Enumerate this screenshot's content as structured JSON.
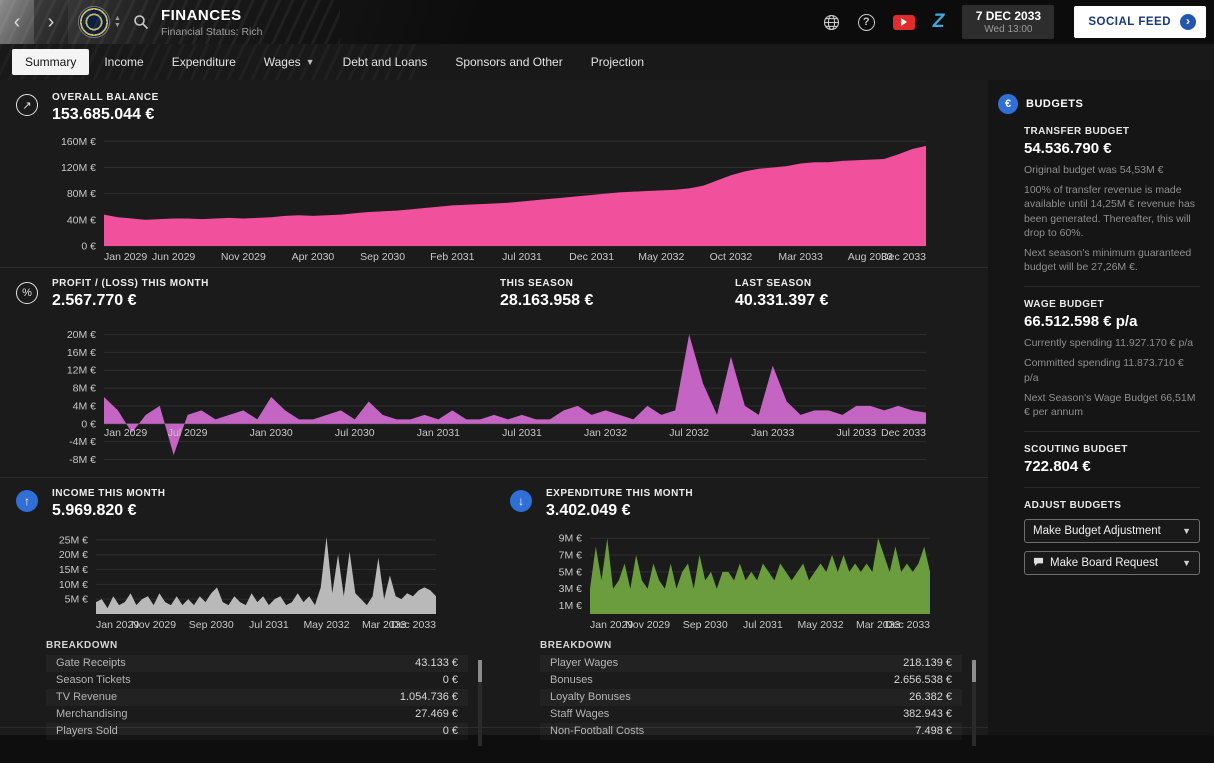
{
  "header": {
    "title": "FINANCES",
    "subtitle": "Financial Status: Rich",
    "date": "7 DEC 2033",
    "date_sub": "Wed 13:00",
    "social_feed_label": "SOCIAL FEED"
  },
  "tabs": [
    {
      "label": "Summary",
      "active": true
    },
    {
      "label": "Income"
    },
    {
      "label": "Expenditure"
    },
    {
      "label": "Wages",
      "dropdown": true
    },
    {
      "label": "Debt and Loans"
    },
    {
      "label": "Sponsors and Other"
    },
    {
      "label": "Projection"
    }
  ],
  "balance_panel": {
    "label": "OVERALL BALANCE",
    "value": "153.685.044 €"
  },
  "profit_panel": {
    "label": "PROFIT / (LOSS) THIS MONTH",
    "value": "2.567.770 €",
    "this_season_label": "THIS SEASON",
    "this_season_value": "28.163.958 €",
    "last_season_label": "LAST SEASON",
    "last_season_value": "40.331.397 €"
  },
  "income_panel": {
    "label": "INCOME THIS MONTH",
    "value": "5.969.820 €",
    "breakdown_label": "BREAKDOWN",
    "rows": [
      {
        "name": "Gate Receipts",
        "value": "43.133 €"
      },
      {
        "name": "Season Tickets",
        "value": "0 €"
      },
      {
        "name": "TV Revenue",
        "value": "1.054.736 €"
      },
      {
        "name": "Merchandising",
        "value": "27.469 €"
      },
      {
        "name": "Players Sold",
        "value": "0 €"
      }
    ]
  },
  "expenditure_panel": {
    "label": "EXPENDITURE THIS MONTH",
    "value": "3.402.049 €",
    "breakdown_label": "BREAKDOWN",
    "rows": [
      {
        "name": "Player Wages",
        "value": "218.139 €"
      },
      {
        "name": "Bonuses",
        "value": "2.656.538 €"
      },
      {
        "name": "Loyalty Bonuses",
        "value": "26.382 €"
      },
      {
        "name": "Staff Wages",
        "value": "382.943 €"
      },
      {
        "name": "Non-Football Costs",
        "value": "7.498 €"
      }
    ]
  },
  "sidebar": {
    "title": "BUDGETS",
    "transfer_label": "TRANSFER BUDGET",
    "transfer_value": "54.536.790 €",
    "transfer_note1": "Original budget was 54,53M €",
    "transfer_note2": "100% of transfer revenue is made available until 14,25M € revenue has been generated. Thereafter, this will drop to 60%.",
    "transfer_note3": "Next season's minimum guaranteed budget will be 27,26M €.",
    "wage_label": "WAGE BUDGET",
    "wage_value": "66.512.598 € p/a",
    "wage_note1": "Currently spending 11.927.170 € p/a",
    "wage_note2": "Committed spending 11.873.710 € p/a",
    "wage_note3": "Next Season's Wage Budget 66,51M € per annum",
    "scouting_label": "SCOUTING BUDGET",
    "scouting_value": "722.804 €",
    "adjust_label": "ADJUST BUDGETS",
    "budget_adjustment_button": "Make Budget Adjustment",
    "board_request_button": "Make Board Request"
  },
  "chart_data": [
    {
      "type": "area",
      "title": "Overall Balance",
      "color": "#f0509c",
      "ylim": [
        0,
        165
      ],
      "yticks": [
        160,
        120,
        80,
        40,
        0
      ],
      "ytick_labels": [
        "160M €",
        "120M €",
        "80M €",
        "40M €",
        "0 €"
      ],
      "xticks": [
        {
          "i": 0,
          "label": "Jan 2029"
        },
        {
          "i": 5,
          "label": "Jun 2029"
        },
        {
          "i": 10,
          "label": "Nov 2029"
        },
        {
          "i": 15,
          "label": "Apr 2030"
        },
        {
          "i": 20,
          "label": "Sep 2030"
        },
        {
          "i": 25,
          "label": "Feb 2031"
        },
        {
          "i": 30,
          "label": "Jul 2031"
        },
        {
          "i": 35,
          "label": "Dec 2031"
        },
        {
          "i": 40,
          "label": "May 2032"
        },
        {
          "i": 45,
          "label": "Oct 2032"
        },
        {
          "i": 50,
          "label": "Mar 2033"
        },
        {
          "i": 55,
          "label": "Aug 2033"
        },
        {
          "i": 59,
          "label": "Dec 2033"
        }
      ],
      "values": [
        48,
        44,
        42,
        40,
        41,
        42,
        42,
        41,
        42,
        43,
        42,
        43,
        44,
        46,
        47,
        46,
        47,
        48,
        50,
        52,
        53,
        54,
        56,
        58,
        60,
        62,
        63,
        64,
        65,
        66,
        68,
        70,
        72,
        74,
        76,
        78,
        80,
        82,
        83,
        84,
        85,
        86,
        88,
        92,
        100,
        108,
        114,
        118,
        120,
        122,
        126,
        128,
        128,
        130,
        131,
        132,
        133,
        140,
        148,
        153
      ]
    },
    {
      "type": "area",
      "title": "Profit / (Loss) This Month",
      "color": "#c465c4",
      "ylim": [
        -9,
        21
      ],
      "yticks": [
        20,
        16,
        12,
        8,
        4,
        0,
        -4,
        -8
      ],
      "ytick_labels": [
        "20M €",
        "16M €",
        "12M €",
        "8M €",
        "4M €",
        "0 €",
        "-4M €",
        "-8M €"
      ],
      "xlabels_at_zero": true,
      "xticks": [
        {
          "i": 0,
          "label": "Jan 2029"
        },
        {
          "i": 6,
          "label": "Jul 2029"
        },
        {
          "i": 12,
          "label": "Jan 2030"
        },
        {
          "i": 18,
          "label": "Jul 2030"
        },
        {
          "i": 24,
          "label": "Jan 2031"
        },
        {
          "i": 30,
          "label": "Jul 2031"
        },
        {
          "i": 36,
          "label": "Jan 2032"
        },
        {
          "i": 42,
          "label": "Jul 2032"
        },
        {
          "i": 48,
          "label": "Jan 2033"
        },
        {
          "i": 54,
          "label": "Jul 2033"
        },
        {
          "i": 59,
          "label": "Dec 2033"
        }
      ],
      "values": [
        6,
        3,
        -2,
        2,
        4,
        -7,
        2,
        3,
        1,
        2,
        3,
        1,
        6,
        3,
        1,
        1,
        2,
        3,
        1,
        5,
        2,
        1,
        1,
        2,
        1,
        3,
        1,
        1,
        2,
        1,
        2,
        1,
        1,
        3,
        4,
        2,
        3,
        2,
        1,
        4,
        2,
        3,
        20,
        9,
        2,
        15,
        4,
        2,
        13,
        5,
        2,
        3,
        3,
        2,
        4,
        4,
        3,
        4,
        3,
        2.5
      ]
    },
    {
      "type": "area",
      "title": "Income This Month",
      "color": "#b9b9b9",
      "ylim": [
        0,
        27
      ],
      "yticks": [
        25,
        20,
        15,
        10,
        5
      ],
      "ytick_labels": [
        "25M €",
        "20M €",
        "15M €",
        "10M €",
        "5M €"
      ],
      "xticks": [
        {
          "i": 0,
          "label": "Jan 2029"
        },
        {
          "i": 10,
          "label": "Nov 2029"
        },
        {
          "i": 20,
          "label": "Sep 2030"
        },
        {
          "i": 30,
          "label": "Jul 2031"
        },
        {
          "i": 40,
          "label": "May 2032"
        },
        {
          "i": 50,
          "label": "Mar 2033"
        },
        {
          "i": 59,
          "label": "Dec 2033"
        }
      ],
      "values": [
        4,
        5,
        2,
        6,
        3,
        4,
        7,
        3,
        5,
        6,
        3,
        7,
        4,
        3,
        6,
        3,
        5,
        3,
        6,
        4,
        7,
        9,
        4,
        3,
        6,
        4,
        3,
        7,
        4,
        6,
        3,
        5,
        6,
        3,
        4,
        7,
        4,
        6,
        3,
        9,
        26,
        7,
        20,
        6,
        21,
        7,
        5,
        3,
        6,
        19,
        5,
        13,
        6,
        5,
        7,
        6,
        8,
        9,
        8,
        6
      ]
    },
    {
      "type": "area",
      "title": "Expenditure This Month",
      "color": "#6b9c3e",
      "ylim": [
        0,
        9.5
      ],
      "yticks": [
        9,
        7,
        5,
        3,
        1
      ],
      "ytick_labels": [
        "9M €",
        "7M €",
        "5M €",
        "3M €",
        "1M €"
      ],
      "xticks": [
        {
          "i": 0,
          "label": "Jan 2029"
        },
        {
          "i": 10,
          "label": "Nov 2029"
        },
        {
          "i": 20,
          "label": "Sep 2030"
        },
        {
          "i": 30,
          "label": "Jul 2031"
        },
        {
          "i": 40,
          "label": "May 2032"
        },
        {
          "i": 50,
          "label": "Mar 2033"
        },
        {
          "i": 59,
          "label": "Dec 2033"
        }
      ],
      "values": [
        3,
        8,
        4,
        9,
        3,
        4,
        6,
        3,
        7,
        4,
        3,
        6,
        4,
        3,
        6,
        3,
        5,
        6,
        3,
        7,
        4,
        5,
        3,
        5,
        5,
        4,
        6,
        4,
        5,
        4,
        6,
        5,
        4,
        6,
        5,
        4,
        5,
        6,
        4,
        5,
        6,
        5,
        7,
        5,
        7,
        5,
        6,
        5,
        6,
        5,
        9,
        7,
        5,
        8,
        5,
        6,
        5,
        6,
        8,
        5
      ]
    }
  ]
}
